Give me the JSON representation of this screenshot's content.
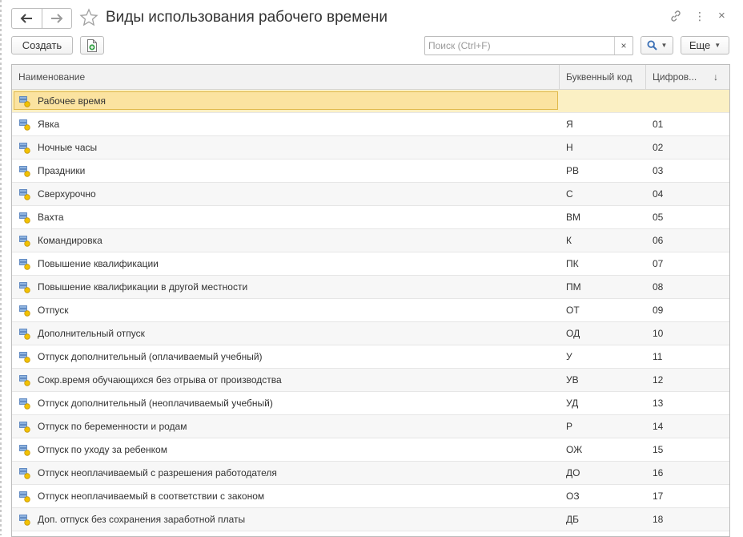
{
  "window": {
    "title": "Виды использования рабочего времени",
    "nav_back": "🡐",
    "nav_forward": "🡒"
  },
  "toolbar": {
    "create_label": "Создать",
    "search_placeholder": "Поиск (Ctrl+F)",
    "search_value": "",
    "clear_label": "×",
    "more_label": "Еще"
  },
  "table": {
    "columns": [
      "Наименование",
      "Буквенный код",
      "Цифров..."
    ],
    "sort_indicator": "↓",
    "rows": [
      {
        "name": "Рабочее время",
        "code": "",
        "num": ""
      },
      {
        "name": "Явка",
        "code": "Я",
        "num": "01"
      },
      {
        "name": "Ночные часы",
        "code": "Н",
        "num": "02"
      },
      {
        "name": "Праздники",
        "code": "РВ",
        "num": "03"
      },
      {
        "name": "Сверхурочно",
        "code": "С",
        "num": "04"
      },
      {
        "name": "Вахта",
        "code": "ВМ",
        "num": "05"
      },
      {
        "name": "Командировка",
        "code": "К",
        "num": "06"
      },
      {
        "name": "Повышение квалификации",
        "code": "ПК",
        "num": "07"
      },
      {
        "name": "Повышение квалификации в другой местности",
        "code": "ПМ",
        "num": "08"
      },
      {
        "name": "Отпуск",
        "code": "ОТ",
        "num": "09"
      },
      {
        "name": "Дополнительный отпуск",
        "code": "ОД",
        "num": "10"
      },
      {
        "name": "Отпуск дополнительный (оплачиваемый учебный)",
        "code": "У",
        "num": "11"
      },
      {
        "name": "Сокр.время обучающихся без отрыва от производства",
        "code": "УВ",
        "num": "12"
      },
      {
        "name": "Отпуск дополнительный (неоплачиваемый учебный)",
        "code": "УД",
        "num": "13"
      },
      {
        "name": "Отпуск по беременности и родам",
        "code": "Р",
        "num": "14"
      },
      {
        "name": "Отпуск по уходу за ребенком",
        "code": "ОЖ",
        "num": "15"
      },
      {
        "name": "Отпуск неоплачиваемый с разрешения работодателя",
        "code": "ДО",
        "num": "16"
      },
      {
        "name": "Отпуск неоплачиваемый в соответствии с законом",
        "code": "ОЗ",
        "num": "17"
      },
      {
        "name": "Доп. отпуск без сохранения заработной платы",
        "code": "ДБ",
        "num": "18"
      },
      {
        "name": "",
        "code": "",
        "num": ""
      }
    ]
  },
  "colors": {
    "selected_row": "#fbf0c4",
    "selected_frame": "#e0b94a",
    "header_bg": "#f2f2f2",
    "search_accent": "#3a6fb5"
  }
}
